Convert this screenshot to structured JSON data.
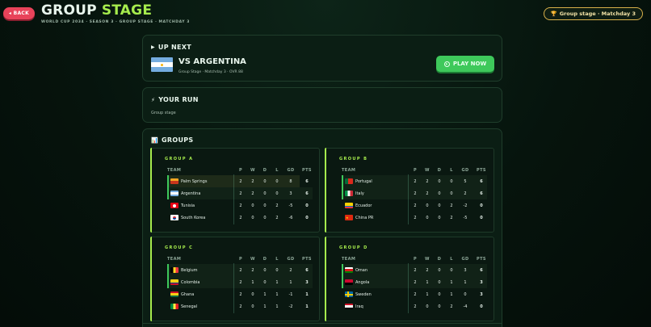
{
  "header": {
    "back_label": "◂ BACK",
    "title_prefix": "GROUP",
    "title_accent": "STAGE",
    "subtitle": "WORLD CUP 2034 · SEASON 3 · GROUP STAGE · MATCHDAY 3",
    "stage_pill": "Group stage · Matchday 3"
  },
  "up_next": {
    "heading": "UP NEXT",
    "opponent": "VS ARGENTINA",
    "meta": "Group Stage · Matchday 3 · OVR 88",
    "play_label": "PLAY NOW"
  },
  "your_run": {
    "heading": "YOUR RUN",
    "text": "Group stage"
  },
  "groups_heading": "GROUPS",
  "columns": [
    "TEAM",
    "P",
    "W",
    "D",
    "L",
    "GD",
    "PTS"
  ],
  "groups": [
    {
      "label": "GROUP A",
      "rows": [
        {
          "team": "Palm Springs",
          "p": "2",
          "w": "2",
          "d": "0",
          "l": "0",
          "gd": "8",
          "pts": "6",
          "flag": "palm"
        },
        {
          "team": "Argentina",
          "p": "2",
          "w": "2",
          "d": "0",
          "l": "0",
          "gd": "3",
          "pts": "6",
          "flag": "arg"
        },
        {
          "team": "Tunisia",
          "p": "2",
          "w": "0",
          "d": "0",
          "l": "2",
          "gd": "-5",
          "pts": "0",
          "flag": "tun"
        },
        {
          "team": "South Korea",
          "p": "2",
          "w": "0",
          "d": "0",
          "l": "2",
          "gd": "-6",
          "pts": "0",
          "flag": "kor"
        }
      ]
    },
    {
      "label": "GROUP B",
      "rows": [
        {
          "team": "Portugal",
          "p": "2",
          "w": "2",
          "d": "0",
          "l": "0",
          "gd": "5",
          "pts": "6",
          "flag": "por"
        },
        {
          "team": "Italy",
          "p": "2",
          "w": "2",
          "d": "0",
          "l": "0",
          "gd": "2",
          "pts": "6",
          "flag": "ita"
        },
        {
          "team": "Ecuador",
          "p": "2",
          "w": "0",
          "d": "0",
          "l": "2",
          "gd": "-2",
          "pts": "0",
          "flag": "ecu"
        },
        {
          "team": "China PR",
          "p": "2",
          "w": "0",
          "d": "0",
          "l": "2",
          "gd": "-5",
          "pts": "0",
          "flag": "chn"
        }
      ]
    },
    {
      "label": "GROUP C",
      "rows": [
        {
          "team": "Belgium",
          "p": "2",
          "w": "2",
          "d": "0",
          "l": "0",
          "gd": "2",
          "pts": "6",
          "flag": "bel"
        },
        {
          "team": "Colombia",
          "p": "2",
          "w": "1",
          "d": "0",
          "l": "1",
          "gd": "1",
          "pts": "3",
          "flag": "col"
        },
        {
          "team": "Ghana",
          "p": "2",
          "w": "0",
          "d": "1",
          "l": "1",
          "gd": "-1",
          "pts": "1",
          "flag": "gha"
        },
        {
          "team": "Senegal",
          "p": "2",
          "w": "0",
          "d": "1",
          "l": "1",
          "gd": "-2",
          "pts": "1",
          "flag": "sen"
        }
      ]
    },
    {
      "label": "GROUP D",
      "rows": [
        {
          "team": "Oman",
          "p": "2",
          "w": "2",
          "d": "0",
          "l": "0",
          "gd": "3",
          "pts": "6",
          "flag": "oma"
        },
        {
          "team": "Angola",
          "p": "2",
          "w": "1",
          "d": "0",
          "l": "1",
          "gd": "1",
          "pts": "3",
          "flag": "ang"
        },
        {
          "team": "Sweden",
          "p": "2",
          "w": "1",
          "d": "0",
          "l": "1",
          "gd": "0",
          "pts": "3",
          "flag": "swe"
        },
        {
          "team": "Iraq",
          "p": "2",
          "w": "0",
          "d": "0",
          "l": "2",
          "gd": "-4",
          "pts": "0",
          "flag": "irq"
        }
      ]
    }
  ],
  "colors": {
    "accent": "#a6ec4d",
    "play": "#3ec95b",
    "back": "#e8435a",
    "pill_border": "#d8b04a"
  }
}
